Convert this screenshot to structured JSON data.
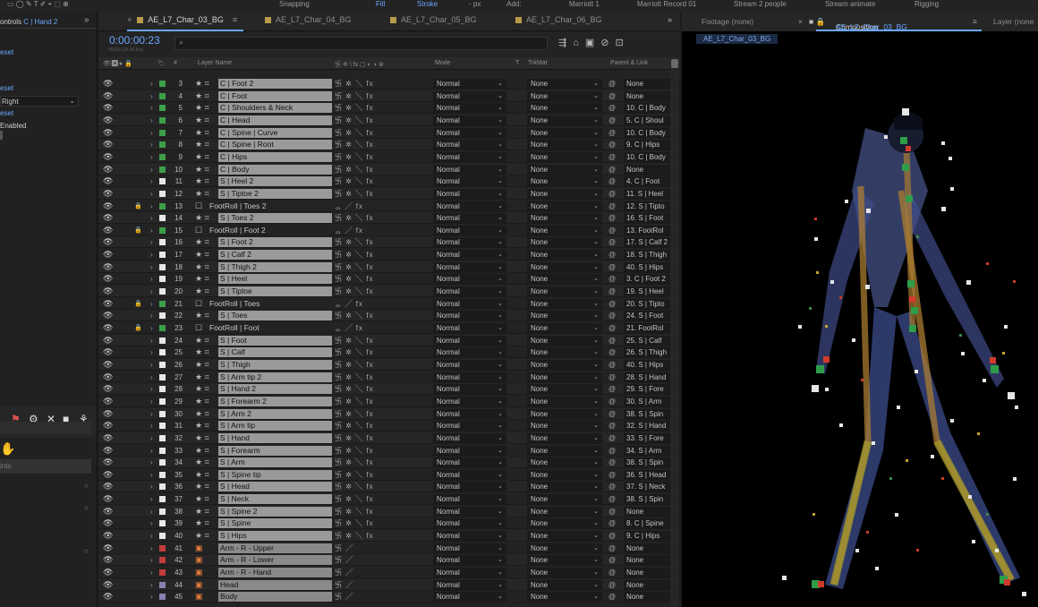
{
  "topbar": {
    "snapping": "Snapping",
    "fill": "Fill",
    "stroke": "Stroke",
    "px": "- px",
    "add": "Add:",
    "workspaces": [
      "Marriott 1",
      "Marriott Record 01",
      "Stream 2 people",
      "Stream animate",
      "Rigging"
    ]
  },
  "tabs": [
    {
      "label": "AE_L7_Char_03_BG",
      "active": true
    },
    {
      "label": "AE_L7_Char_04_BG",
      "active": false
    },
    {
      "label": "AE_L7_Char_05_BG",
      "active": false
    },
    {
      "label": "AE_L7_Char_06_BG",
      "active": false
    }
  ],
  "timeline": {
    "timecode": "0:00:00:23",
    "fps": "00023 (25.00 fps)",
    "search_placeholder": ""
  },
  "columns": {
    "layer_name": "Layer Name",
    "mode": "Mode",
    "t": "T",
    "trkmat": "TrkMat",
    "parent": "Parent & Link"
  },
  "left_panel": {
    "title": "ontrols",
    "title_highlight": "C | Hand 2",
    "lines": [
      "eset",
      "eset",
      "Right",
      "eset",
      "Enabled"
    ],
    "bottom_label": "ints"
  },
  "right_panel": {
    "footage_tab": "Footage (none)",
    "comp_tab_prefix": "Composition",
    "comp_tab_name": "AE_L7_Char_03_BG",
    "layer_tab": "Layer (none",
    "comp_label": "AE_L7_Char_03_BG"
  },
  "colors": {
    "green_label": "#3e9f4a",
    "red_label": "#c23c3c",
    "purple_label": "#8a7fb3",
    "white_label": "#e8e8e8",
    "timecode": "#6aa6ff"
  },
  "layers": [
    {
      "n": "3",
      "name": "C | Foot 2",
      "mode": "Normal",
      "trk": "None",
      "parent": "None",
      "color": "green",
      "type": "null"
    },
    {
      "n": "4",
      "name": "C | Foot",
      "mode": "Normal",
      "trk": "None",
      "parent": "None",
      "color": "green",
      "type": "null"
    },
    {
      "n": "5",
      "name": "C | Shoulders & Neck",
      "mode": "Normal",
      "trk": "None",
      "parent": "10. C | Body",
      "color": "green",
      "type": "null"
    },
    {
      "n": "6",
      "name": "C | Head",
      "mode": "Normal",
      "trk": "None",
      "parent": "5. C | Shoul",
      "color": "green",
      "type": "null"
    },
    {
      "n": "7",
      "name": "C | Spine | Curve",
      "mode": "Normal",
      "trk": "None",
      "parent": "10. C | Body",
      "color": "green",
      "type": "null"
    },
    {
      "n": "8",
      "name": "C | Spine | Root",
      "mode": "Normal",
      "trk": "None",
      "parent": "9. C | Hips",
      "color": "green",
      "type": "null"
    },
    {
      "n": "9",
      "name": "C | Hips",
      "mode": "Normal",
      "trk": "None",
      "parent": "10. C | Body",
      "color": "green",
      "type": "null"
    },
    {
      "n": "10",
      "name": "C | Body",
      "mode": "Normal",
      "trk": "None",
      "parent": "None",
      "color": "green",
      "type": "null"
    },
    {
      "n": "11",
      "name": "S | Heel 2",
      "mode": "Normal",
      "trk": "None",
      "parent": "4. C | Foot",
      "color": "white",
      "type": "null"
    },
    {
      "n": "12",
      "name": "S | Tiptoe 2",
      "mode": "Normal",
      "trk": "None",
      "parent": "11. S | Heel",
      "color": "white",
      "type": "null"
    },
    {
      "n": "13",
      "name": "FootRoll | Toes 2",
      "mode": "Normal",
      "trk": "None",
      "parent": "12. S | Tipto",
      "color": "green",
      "type": "shape",
      "locked": true
    },
    {
      "n": "14",
      "name": "S | Toes 2",
      "mode": "Normal",
      "trk": "None",
      "parent": "16. S | Foot",
      "color": "white",
      "type": "null"
    },
    {
      "n": "15",
      "name": "FootRoll | Foot 2",
      "mode": "Normal",
      "trk": "None",
      "parent": "13. FootRol",
      "color": "green",
      "type": "shape",
      "locked": true
    },
    {
      "n": "16",
      "name": "S | Foot 2",
      "mode": "Normal",
      "trk": "None",
      "parent": "17. S | Calf 2",
      "color": "white",
      "type": "null"
    },
    {
      "n": "17",
      "name": "S | Calf 2",
      "mode": "Normal",
      "trk": "None",
      "parent": "18. S | Thigh",
      "color": "white",
      "type": "null"
    },
    {
      "n": "18",
      "name": "S | Thigh 2",
      "mode": "Normal",
      "trk": "None",
      "parent": "40. S | Hips",
      "color": "white",
      "type": "null"
    },
    {
      "n": "19",
      "name": "S | Heel",
      "mode": "Normal",
      "trk": "None",
      "parent": "3. C | Foot 2",
      "color": "white",
      "type": "null"
    },
    {
      "n": "20",
      "name": "S | Tiptoe",
      "mode": "Normal",
      "trk": "None",
      "parent": "19. S | Heel",
      "color": "white",
      "type": "null"
    },
    {
      "n": "21",
      "name": "FootRoll | Toes",
      "mode": "Normal",
      "trk": "None",
      "parent": "20. S | Tipto",
      "color": "green",
      "type": "shape",
      "locked": true
    },
    {
      "n": "22",
      "name": "S | Toes",
      "mode": "Normal",
      "trk": "None",
      "parent": "24. S | Foot",
      "color": "white",
      "type": "null"
    },
    {
      "n": "23",
      "name": "FootRoll | Foot",
      "mode": "Normal",
      "trk": "None",
      "parent": "21. FootRol",
      "color": "green",
      "type": "shape",
      "locked": true
    },
    {
      "n": "24",
      "name": "S | Foot",
      "mode": "Normal",
      "trk": "None",
      "parent": "25. S | Calf",
      "color": "white",
      "type": "null"
    },
    {
      "n": "25",
      "name": "S | Calf",
      "mode": "Normal",
      "trk": "None",
      "parent": "26. S | Thigh",
      "color": "white",
      "type": "null"
    },
    {
      "n": "26",
      "name": "S | Thigh",
      "mode": "Normal",
      "trk": "None",
      "parent": "40. S | Hips",
      "color": "white",
      "type": "null"
    },
    {
      "n": "27",
      "name": "S | Arm tip 2",
      "mode": "Normal",
      "trk": "None",
      "parent": "28. S | Hand",
      "color": "white",
      "type": "null"
    },
    {
      "n": "28",
      "name": "S | Hand 2",
      "mode": "Normal",
      "trk": "None",
      "parent": "29. S | Fore",
      "color": "white",
      "type": "null"
    },
    {
      "n": "29",
      "name": "S | Forearm 2",
      "mode": "Normal",
      "trk": "None",
      "parent": "30. S | Arm",
      "color": "white",
      "type": "null"
    },
    {
      "n": "30",
      "name": "S | Arm 2",
      "mode": "Normal",
      "trk": "None",
      "parent": "38. S | Spin",
      "color": "white",
      "type": "null"
    },
    {
      "n": "31",
      "name": "S | Arm tip",
      "mode": "Normal",
      "trk": "None",
      "parent": "32. S | Hand",
      "color": "white",
      "type": "null"
    },
    {
      "n": "32",
      "name": "S | Hand",
      "mode": "Normal",
      "trk": "None",
      "parent": "33. S | Fore",
      "color": "white",
      "type": "null"
    },
    {
      "n": "33",
      "name": "S | Forearm",
      "mode": "Normal",
      "trk": "None",
      "parent": "34. S | Arm",
      "color": "white",
      "type": "null"
    },
    {
      "n": "34",
      "name": "S | Arm",
      "mode": "Normal",
      "trk": "None",
      "parent": "38. S | Spin",
      "color": "white",
      "type": "null"
    },
    {
      "n": "35",
      "name": "S | Spine tip",
      "mode": "Normal",
      "trk": "None",
      "parent": "36. S | Head",
      "color": "white",
      "type": "null"
    },
    {
      "n": "36",
      "name": "S | Head",
      "mode": "Normal",
      "trk": "None",
      "parent": "37. S | Neck",
      "color": "white",
      "type": "null"
    },
    {
      "n": "37",
      "name": "S | Neck",
      "mode": "Normal",
      "trk": "None",
      "parent": "38. S | Spin",
      "color": "white",
      "type": "null"
    },
    {
      "n": "38",
      "name": "S | Spine 2",
      "mode": "Normal",
      "trk": "None",
      "parent": "None",
      "color": "white",
      "type": "null"
    },
    {
      "n": "39",
      "name": "S | Spine",
      "mode": "Normal",
      "trk": "None",
      "parent": "8. C | Spine",
      "color": "white",
      "type": "null"
    },
    {
      "n": "40",
      "name": "S | Hips",
      "mode": "Normal",
      "trk": "None",
      "parent": "9. C | Hips",
      "color": "white",
      "type": "null"
    },
    {
      "n": "41",
      "name": "Arm - R - Upper",
      "mode": "Normal",
      "trk": "None",
      "parent": "None",
      "color": "red",
      "type": "puppet"
    },
    {
      "n": "42",
      "name": "Arm - R - Lower",
      "mode": "Normal",
      "trk": "None",
      "parent": "None",
      "color": "red",
      "type": "puppet"
    },
    {
      "n": "43",
      "name": "Arm - R - Hand",
      "mode": "Normal",
      "trk": "None",
      "parent": "None",
      "color": "red",
      "type": "puppet"
    },
    {
      "n": "44",
      "name": "Head",
      "mode": "Normal",
      "trk": "None",
      "parent": "None",
      "color": "purple",
      "type": "puppet"
    },
    {
      "n": "45",
      "name": "Body",
      "mode": "Normal",
      "trk": "None",
      "parent": "None",
      "color": "purple",
      "type": "puppet"
    }
  ]
}
